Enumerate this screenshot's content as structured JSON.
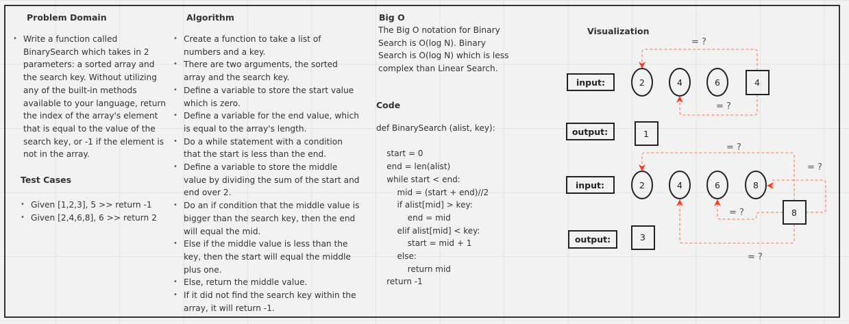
{
  "problem_domain": {
    "title": "Problem Domain",
    "bullets": [
      "Write a function called BinarySearch which takes in 2 parameters: a sorted array and the search key. Without utilizing any of the built-in methods available to your language, return the index of the array's element that is equal to the value of the search key, or -1 if the element is not in the array."
    ]
  },
  "test_cases": {
    "title": "Test Cases",
    "items": [
      "Given [1,2,3], 5 >> return -1",
      "Given [2,4,6,8], 6 >> return 2"
    ]
  },
  "algorithm": {
    "title": "Algorithm",
    "bullets": [
      "Create a function to take a list of numbers and a key.",
      "There are two arguments, the sorted array and the search key.",
      "Define a variable to store the start value which is zero.",
      "Define a variable for the end value, which is equal to the array's length.",
      "Do a while statement with a condition that the start is less than the end.",
      "Define a variable to store the middle value by dividing the sum of the start and end over 2.",
      "Do an if condition that the middle value is bigger than the search key, then the end will equal the mid.",
      "Else if the middle value is less than the key, then the start will equal the middle plus one.",
      "Else, return the middle value.",
      "If it did not find the search key within the array, it will return -1."
    ]
  },
  "big_o": {
    "title": "Big O",
    "text": "The Big O notation for Binary Search is O(log N). Binary Search is O(log N) which is less complex than Linear Search."
  },
  "code": {
    "title": "Code",
    "lines": [
      "def BinarySearch (alist, key):",
      "",
      "    start = 0",
      "    end = len(alist)",
      "    while start < end:",
      "        mid = (start + end)//2",
      "        if alist[mid] > key:",
      "            end = mid",
      "        elif alist[mid] < key:",
      "            start = mid + 1",
      "        else:",
      "            return mid",
      "    return -1"
    ]
  },
  "visualization": {
    "title": "Visualization",
    "arrow_color": "#ff5a3c",
    "example1": {
      "input_label": "input:",
      "array": [
        "2",
        "4",
        "6"
      ],
      "key": "4",
      "output_label": "output:",
      "output": "1",
      "cmp_label": "= ?"
    },
    "example2": {
      "input_label": "input:",
      "array": [
        "2",
        "4",
        "6",
        "8"
      ],
      "key": "8",
      "output_label": "output:",
      "output": "3",
      "cmp_label": "= ?"
    }
  }
}
